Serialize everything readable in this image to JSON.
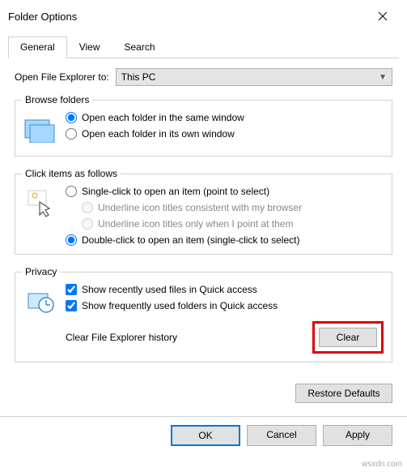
{
  "window": {
    "title": "Folder Options"
  },
  "tabs": {
    "general": "General",
    "view": "View",
    "search": "Search"
  },
  "open_to": {
    "label": "Open File Explorer to:",
    "value": "This PC"
  },
  "browse": {
    "legend": "Browse folders",
    "same": "Open each folder in the same window",
    "own": "Open each folder in its own window"
  },
  "click": {
    "legend": "Click items as follows",
    "single": "Single-click to open an item (point to select)",
    "sub1": "Underline icon titles consistent with my browser",
    "sub2": "Underline icon titles only when I point at them",
    "double": "Double-click to open an item (single-click to select)"
  },
  "privacy": {
    "legend": "Privacy",
    "recent": "Show recently used files in Quick access",
    "frequent": "Show frequently used folders in Quick access",
    "clear_label": "Clear File Explorer history",
    "clear_btn": "Clear"
  },
  "buttons": {
    "restore": "Restore Defaults",
    "ok": "OK",
    "cancel": "Cancel",
    "apply": "Apply"
  },
  "watermark": "wsxdn.com"
}
